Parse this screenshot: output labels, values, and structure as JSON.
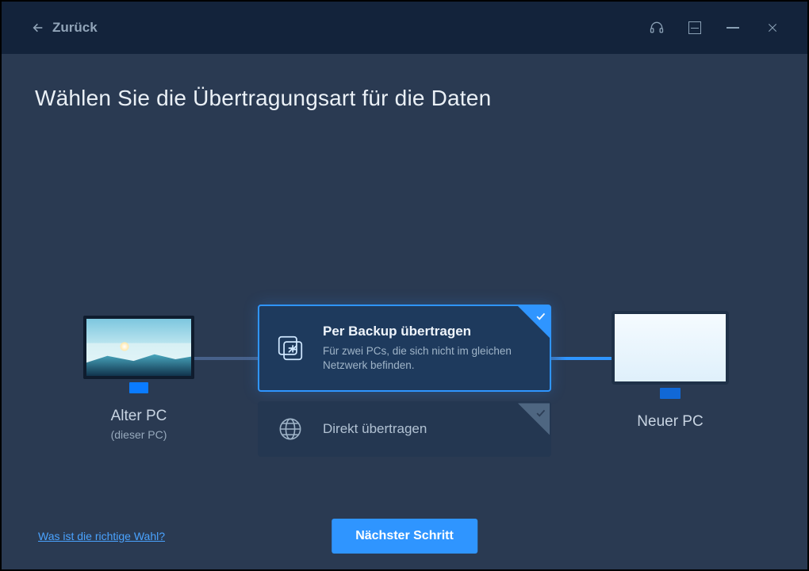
{
  "titlebar": {
    "back_label": "Zurück"
  },
  "page": {
    "title": "Wählen Sie die Übertragungsart für die Daten"
  },
  "old_pc": {
    "label": "Alter PC",
    "sub": "(dieser PC)"
  },
  "new_pc": {
    "label": "Neuer PC"
  },
  "options": {
    "backup": {
      "title": "Per Backup übertragen",
      "desc": "Für zwei PCs, die sich nicht im gleichen Netzwerk befinden."
    },
    "direct": {
      "title": "Direkt übertragen"
    }
  },
  "footer": {
    "help": "Was ist die richtige Wahl?",
    "next": "Nächster Schritt"
  },
  "colors": {
    "accent": "#2f95ff",
    "bg": "#2a3a52",
    "titlebar": "#13233b"
  }
}
